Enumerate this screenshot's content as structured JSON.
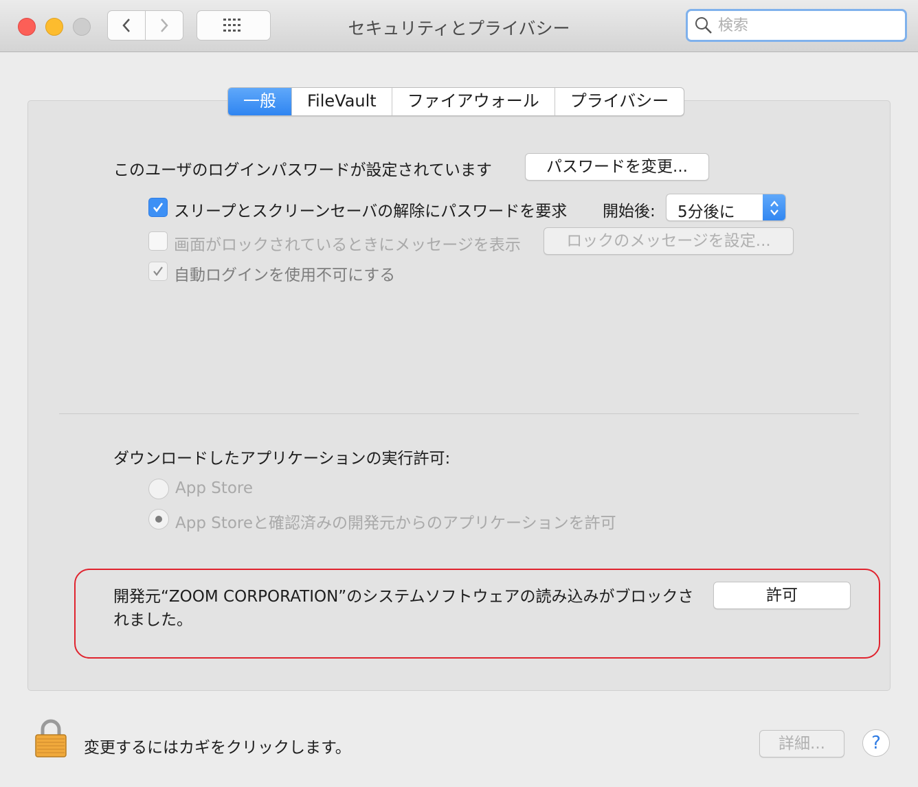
{
  "window": {
    "title": "セキュリティとプライバシー",
    "search_placeholder": "検索"
  },
  "tabs": [
    {
      "label": "一般",
      "active": true
    },
    {
      "label": "FileVault",
      "active": false
    },
    {
      "label": "ファイアウォール",
      "active": false
    },
    {
      "label": "プライバシー",
      "active": false
    }
  ],
  "general": {
    "password_text": "このユーザのログインパスワードが設定されています",
    "change_password_button": "パスワードを変更...",
    "require_password_label": "スリープとスクリーンセーバの解除にパスワードを要求",
    "require_password_checked": true,
    "start_after_label": "開始後:",
    "start_after_value": "5分後に",
    "lock_message_label": "画面がロックされているときにメッセージを表示",
    "lock_message_checked": false,
    "lock_message_button": "ロックのメッセージを設定...",
    "disable_autologin_label": "自動ログインを使用不可にする",
    "disable_autologin_checked": true
  },
  "downloads": {
    "heading": "ダウンロードしたアプリケーションの実行許可:",
    "options": [
      {
        "label": "App Store",
        "selected": false
      },
      {
        "label": "App Storeと確認済みの開発元からのアプリケーションを許可",
        "selected": true
      }
    ]
  },
  "blocked": {
    "message": "開発元“ZOOM CORPORATION”のシステムソフトウェアの読み込みがブロックされました。",
    "allow_button": "許可",
    "highlight_color": "#e0232e"
  },
  "footer": {
    "lock_text": "変更するにはカギをクリックします。",
    "advanced_button": "詳細...",
    "help_label": "?"
  },
  "colors": {
    "accent": "#3d90f5",
    "window_bg": "#ececec"
  }
}
